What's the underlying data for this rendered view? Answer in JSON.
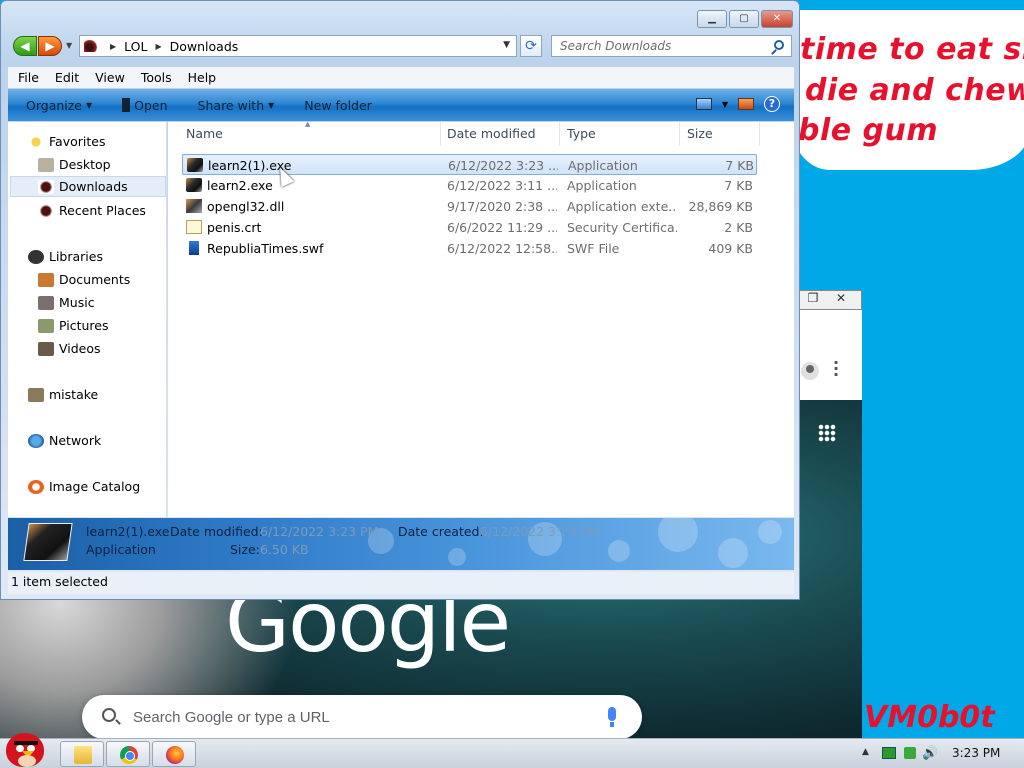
{
  "desktop": {
    "speech_lines": [
      "time to eat shit",
      "die and chew",
      "ble gum"
    ],
    "watermark": "VM0b0t"
  },
  "chrome": {
    "search_placeholder": "Search Google or type a URL",
    "logo_text": "Google"
  },
  "explorer": {
    "breadcrumbs": [
      "LOL",
      "Downloads"
    ],
    "search_placeholder": "Search Downloads",
    "menu": [
      "File",
      "Edit",
      "View",
      "Tools",
      "Help"
    ],
    "commands": {
      "organize": "Organize",
      "open": "Open",
      "share_with": "Share with",
      "new_folder": "New folder"
    },
    "nav": {
      "favorites": "Favorites",
      "desktop": "Desktop",
      "downloads": "Downloads",
      "recent_places": "Recent Places",
      "libraries": "Libraries",
      "documents": "Documents",
      "music": "Music",
      "pictures": "Pictures",
      "videos": "Videos",
      "mistake": "mistake",
      "network": "Network",
      "image_catalog": "Image Catalog"
    },
    "columns": {
      "name": "Name",
      "date_modified": "Date modified",
      "type": "Type",
      "size": "Size"
    },
    "files": [
      {
        "name": "learn2(1).exe",
        "date": "6/12/2022 3:23 ...",
        "type": "Application",
        "size": "7 KB",
        "icon": "exe-icon"
      },
      {
        "name": "learn2.exe",
        "date": "6/12/2022 3:11 ...",
        "type": "Application",
        "size": "7 KB",
        "icon": "exe-icon"
      },
      {
        "name": "opengl32.dll",
        "date": "9/17/2020 2:38 ...",
        "type": "Application exte...",
        "size": "28,869 KB",
        "icon": "dll-icon"
      },
      {
        "name": "penis.crt",
        "date": "6/6/2022 11:29 ...",
        "type": "Security Certifica...",
        "size": "2 KB",
        "icon": "certificate-icon"
      },
      {
        "name": "RepubliaTimes.swf",
        "date": "6/12/2022 12:58...",
        "type": "SWF File",
        "size": "409 KB",
        "icon": "swf-icon"
      }
    ],
    "details": {
      "filename": "learn2(1).exe",
      "filetype": "Application",
      "date_modified_label": "Date modified:",
      "date_modified_value": "6/12/2022 3:23 PM",
      "date_created_label": "Date created:",
      "date_created_value": "6/12/2022 3:23 PM",
      "size_label": "Size:",
      "size_value": "6.50 KB"
    },
    "status": "1 item selected"
  },
  "taskbar": {
    "clock": "3:23 PM"
  }
}
